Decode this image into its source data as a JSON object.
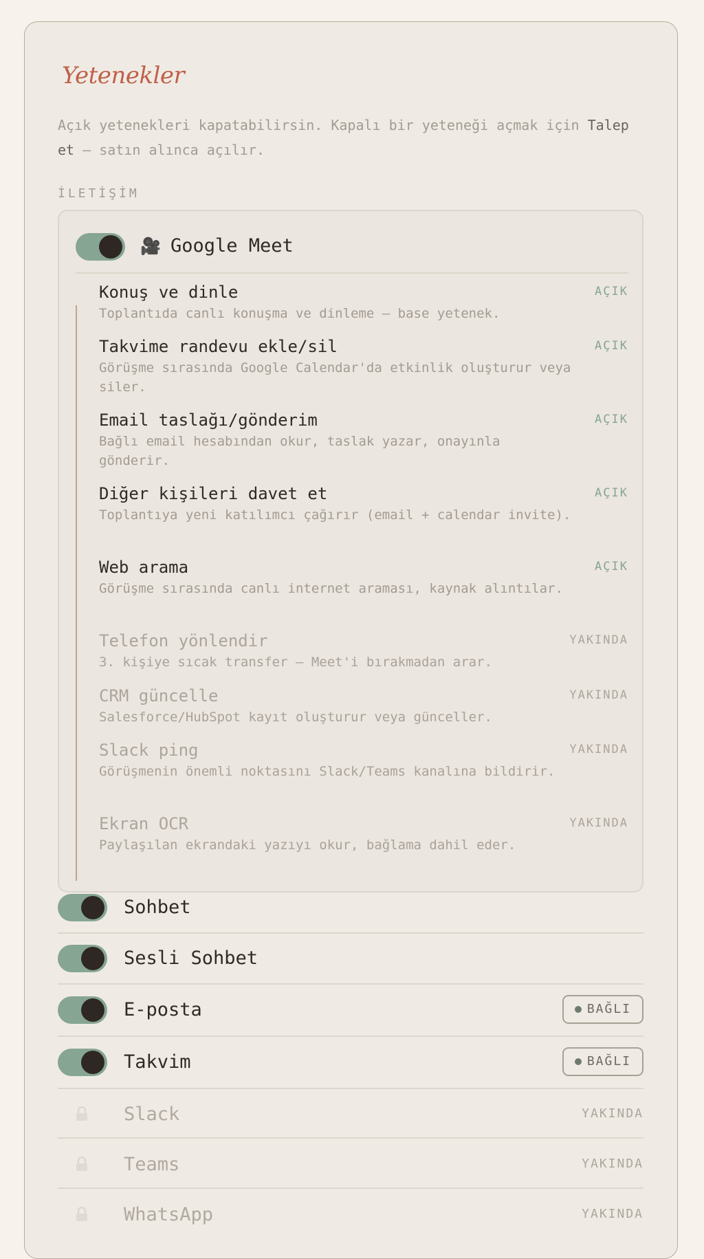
{
  "header": {
    "title": "Yetenekler",
    "intro_before": "Açık yetenekleri kapatabilirsin. Kapalı bir yeteneği açmak için ",
    "intro_emphasis": "Talep et",
    "intro_after": " — satın alınca açılır."
  },
  "section": {
    "label": "İLETİŞİM"
  },
  "meet": {
    "icon": "movie-camera-icon",
    "icon_glyph": "🎥",
    "name": "Google Meet",
    "enabled": true,
    "features": [
      {
        "name": "Konuş ve dinle",
        "desc": "Toplantıda canlı konuşma ve dinleme — base yetenek.",
        "status": "AÇIK"
      },
      {
        "name": "Takvime randevu ekle/sil",
        "desc": "Görüşme sırasında Google Calendar'da etkinlik oluşturur veya siler.",
        "status": "AÇIK"
      },
      {
        "name": "Email taslağı/gönderim",
        "desc": "Bağlı email hesabından okur, taslak yazar, onayınla gönderir.",
        "status": "AÇIK"
      },
      {
        "name": "Diğer kişileri davet et",
        "desc": "Toplantıya yeni katılımcı çağırır (email + calendar invite).",
        "status": "AÇIK"
      },
      {
        "name": "Web arama",
        "desc": "Görüşme sırasında canlı internet araması, kaynak alıntılar.",
        "status": "AÇIK"
      },
      {
        "name": "Telefon yönlendir",
        "desc": "3. kişiye sıcak transfer — Meet'i bırakmadan arar.",
        "status": "YAKINDA"
      },
      {
        "name": "CRM güncelle",
        "desc": "Salesforce/HubSpot kayıt oluşturur veya günceller.",
        "status": "YAKINDA"
      },
      {
        "name": "Slack ping",
        "desc": "Görüşmenin önemli noktasını Slack/Teams kanalına bildirir.",
        "status": "YAKINDA"
      },
      {
        "name": "Ekran OCR",
        "desc": "Paylaşılan ekrandaki yazıyı okur, bağlama dahil eder.",
        "status": "YAKINDA"
      }
    ]
  },
  "channels": [
    {
      "name": "Sohbet",
      "enabled": true
    },
    {
      "name": "Sesli Sohbet",
      "enabled": true
    },
    {
      "name": "E-posta",
      "enabled": true,
      "badge": "BAĞLI"
    },
    {
      "name": "Takvim",
      "enabled": true,
      "badge": "BAĞLI"
    },
    {
      "name": "Slack",
      "locked": true,
      "icon": "lock-icon",
      "status": "YAKINDA"
    },
    {
      "name": "Teams",
      "locked": true,
      "icon": "lock-icon",
      "status": "YAKINDA"
    },
    {
      "name": "WhatsApp",
      "locked": true,
      "icon": "lock-icon",
      "status": "YAKINDA"
    }
  ],
  "colors": {
    "accent_title": "#c0604a",
    "toggle_on": "#86a593",
    "status_on": "#86a593",
    "panel_bg": "#efebe4",
    "page_bg": "#f7f3ec"
  }
}
